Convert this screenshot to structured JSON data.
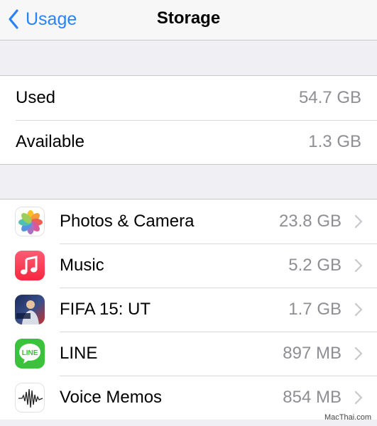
{
  "navbar": {
    "back_label": "Usage",
    "title": "Storage"
  },
  "summary": [
    {
      "label": "Used",
      "value": "54.7 GB"
    },
    {
      "label": "Available",
      "value": "1.3 GB"
    }
  ],
  "apps": [
    {
      "name": "Photos & Camera",
      "size": "23.8 GB",
      "icon": "photos-icon"
    },
    {
      "name": "Music",
      "size": "5.2 GB",
      "icon": "music-icon"
    },
    {
      "name": "FIFA 15: UT",
      "size": "1.7 GB",
      "icon": "fifa-icon"
    },
    {
      "name": "LINE",
      "size": "897 MB",
      "icon": "line-icon"
    },
    {
      "name": "Voice Memos",
      "size": "854 MB",
      "icon": "voice-memos-icon"
    }
  ],
  "icon_text": {
    "line": "LINE"
  },
  "watermark": "MacThai.com",
  "colors": {
    "accent": "#2a82f6",
    "secondary_text": "#8e8e93",
    "background": "#efeff4"
  }
}
